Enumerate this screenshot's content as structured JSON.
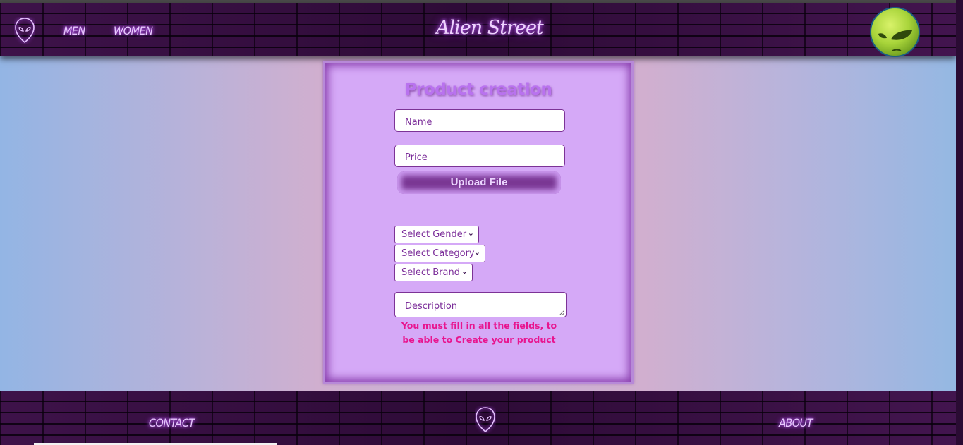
{
  "header": {
    "nav": [
      {
        "label": "MEN"
      },
      {
        "label": "WOMEN"
      }
    ],
    "brand": "Alien Street"
  },
  "form": {
    "title": "Product creation",
    "name_placeholder": "Name",
    "price_placeholder": "Price",
    "upload_label": "Upload File",
    "gender_select": "Select Gender",
    "category_select": "Select Category",
    "brand_select": "Select Brand",
    "description_placeholder": "Description",
    "error_message": "You must fill in all the fields, to be able to Create your product"
  },
  "footer": {
    "contact": "CONTACT",
    "about": "ABOUT"
  },
  "colors": {
    "accent": "#b972ef",
    "card_bg": "#d5a9f7",
    "error": "#e8158f",
    "nav_glow": "#c26bff"
  },
  "icons": {
    "logo": "alien-head-icon",
    "avatar": "alien-avatar",
    "select_arrow": "chevron-down-icon"
  }
}
